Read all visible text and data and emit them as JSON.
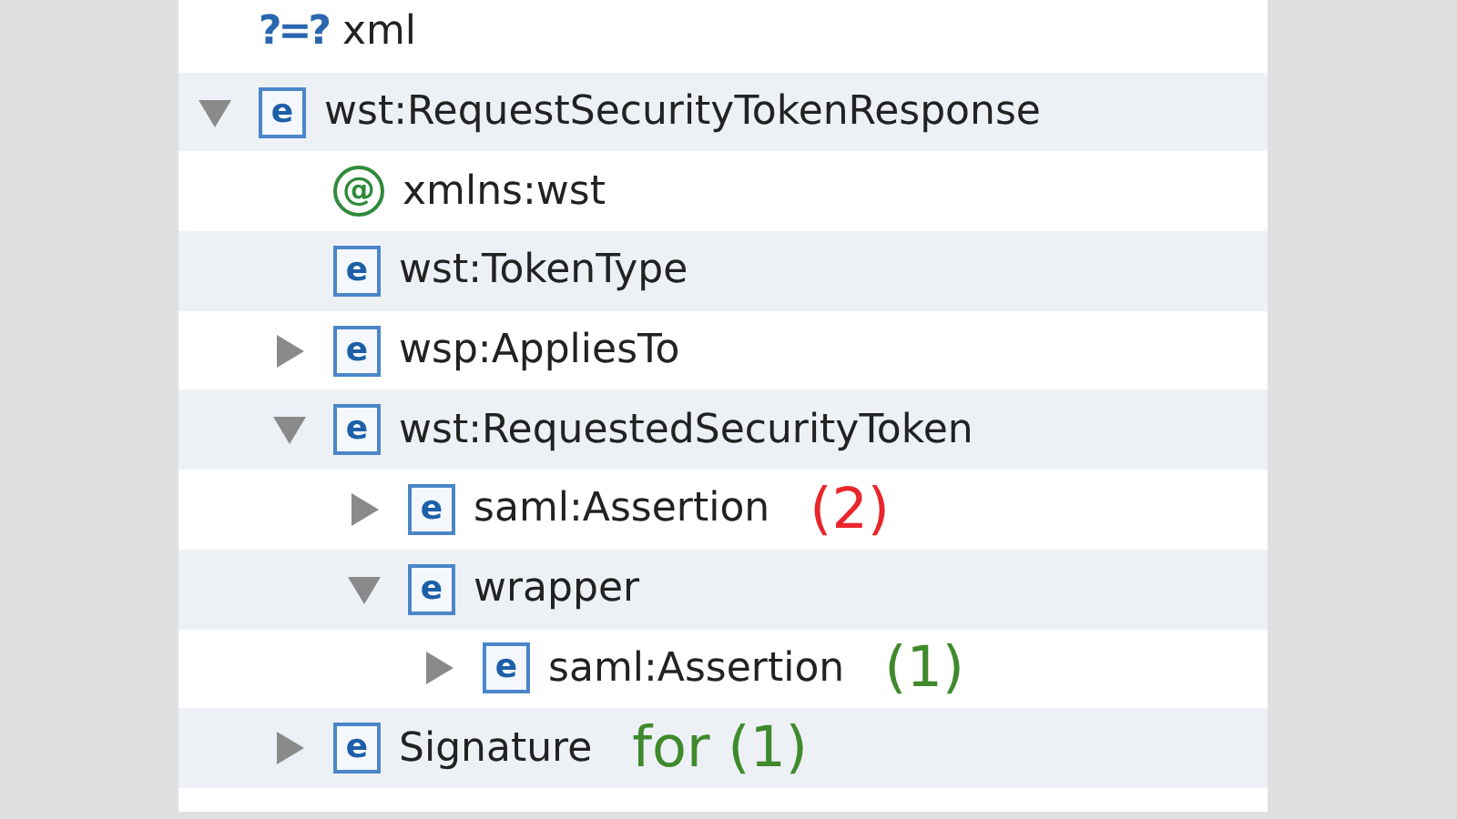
{
  "tree": [
    {
      "kind": "instruction",
      "badge": "?=?",
      "label": "xml"
    },
    {
      "kind": "element",
      "badge": "e",
      "label": "wst:RequestSecurityTokenResponse",
      "expanded": true,
      "children": [
        {
          "kind": "attribute",
          "badge": "@",
          "label": "xmlns:wst"
        },
        {
          "kind": "element",
          "badge": "e",
          "label": "wst:TokenType"
        },
        {
          "kind": "element",
          "badge": "e",
          "label": "wsp:AppliesTo",
          "expanded": false
        },
        {
          "kind": "element",
          "badge": "e",
          "label": "wst:RequestedSecurityToken",
          "expanded": true,
          "children": [
            {
              "kind": "element",
              "badge": "e",
              "label": "saml:Assertion",
              "expanded": false,
              "note": {
                "text": "(2)",
                "color": "#e8262b"
              }
            },
            {
              "kind": "element",
              "badge": "e",
              "label": "wrapper",
              "expanded": true,
              "children": [
                {
                  "kind": "element",
                  "badge": "e",
                  "label": "saml:Assertion",
                  "expanded": false,
                  "note": {
                    "text": "(1)",
                    "color": "#3f8a2c"
                  }
                }
              ]
            }
          ]
        },
        {
          "kind": "element",
          "badge": "e",
          "label": "Signature",
          "expanded": false,
          "note": {
            "text": "for (1)",
            "color": "#3f8a2c"
          }
        }
      ]
    }
  ]
}
